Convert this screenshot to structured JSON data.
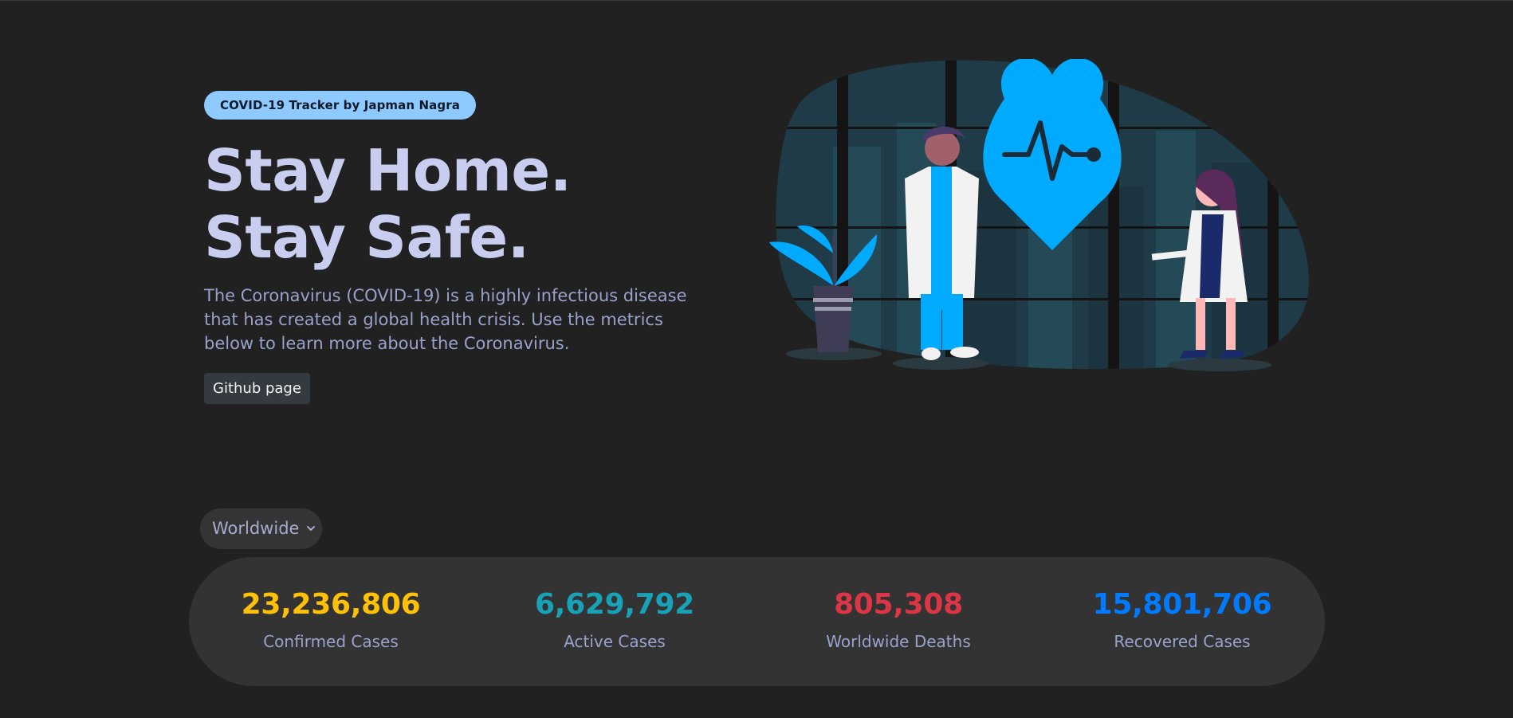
{
  "hero": {
    "badge": "COVID-19 Tracker by Japman Nagra",
    "headline_line1": "Stay Home.",
    "headline_line2": "Stay Safe.",
    "description": "The Coronavirus (COVID-19) is a highly infectious disease that has created a global health crisis. Use the metrics below to learn more about the Coronavirus.",
    "github_button": "Github page"
  },
  "selector": {
    "value": "Worldwide"
  },
  "stats": [
    {
      "value": "23,236,806",
      "label": "Confirmed Cases",
      "color": "#ffc107"
    },
    {
      "value": "6,629,792",
      "label": "Active Cases",
      "color": "#17a2b8"
    },
    {
      "value": "805,308",
      "label": "Worldwide Deaths",
      "color": "#dc3545"
    },
    {
      "value": "15,801,706",
      "label": "Recovered Cases",
      "color": "#007bff"
    }
  ],
  "colors": {
    "background": "#212121",
    "badge": "#8ec9ff",
    "accent_blue": "#00b0ff",
    "card": "#333333"
  },
  "icons": [
    "chevron-down-icon",
    "heartbeat-icon"
  ]
}
